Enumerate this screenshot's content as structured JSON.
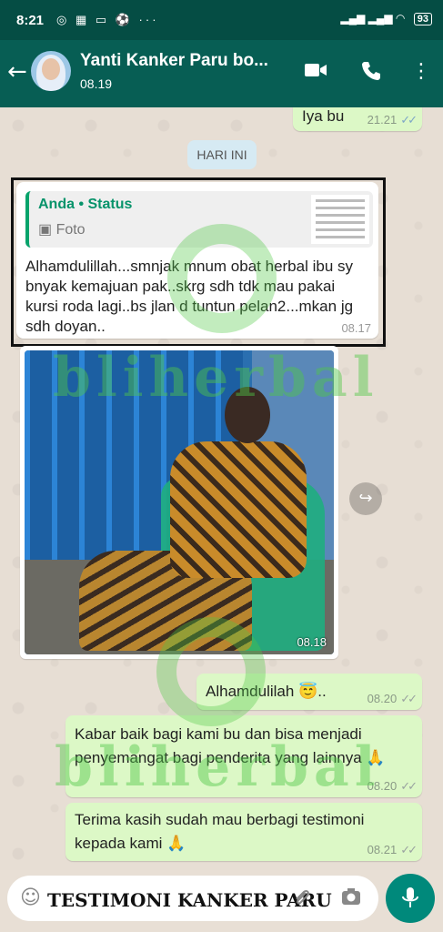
{
  "status_bar": {
    "time": "8:21",
    "icons": "◎ ▦ ▭ ⚽ ···",
    "signal": "▂▄▆ ▂▄▆ ◠",
    "battery": "93"
  },
  "header": {
    "back_icon": "←",
    "title": "Yanti Kanker Paru bo...",
    "subtitle": "08.19",
    "video_icon": "▶",
    "call_icon": "☎",
    "menu_icon": "⋮"
  },
  "chat": {
    "m1": {
      "text": "Iya bu",
      "time": "21.21"
    },
    "day_label": "HARI INI",
    "reply": {
      "quote_author": "Anda • Status",
      "quote_type": "▣ Foto",
      "text": "Alhamdulillah...smnjak mnum obat herbal ibu sy bnyak kemajuan pak..skrg sdh tdk mau pakai kursi roda lagi..bs jlan d tuntun pelan2...mkan jg sdh doyan..",
      "time": "08.17"
    },
    "photo": {
      "time": "08.18",
      "forward_icon": "↪"
    },
    "m2": {
      "text": "Alhamdulilah 😇..",
      "time": "08.20"
    },
    "m3": {
      "text": "Kabar baik bagi kami bu dan bisa menjadi penyemangat bagi penderita yang lainnya 🙏",
      "time": "08.20"
    },
    "m4": {
      "text": "Terima kasih sudah mau berbagi testimoni kepada kami 🙏",
      "time": "08.21"
    },
    "watermark": "bliherbal"
  },
  "composer": {
    "emoji_icon": "☺",
    "caption": "TESTIMONI KANKER PARU",
    "attach_icon": "⌁",
    "camera_icon": "◙",
    "mic_icon": "🎤"
  }
}
